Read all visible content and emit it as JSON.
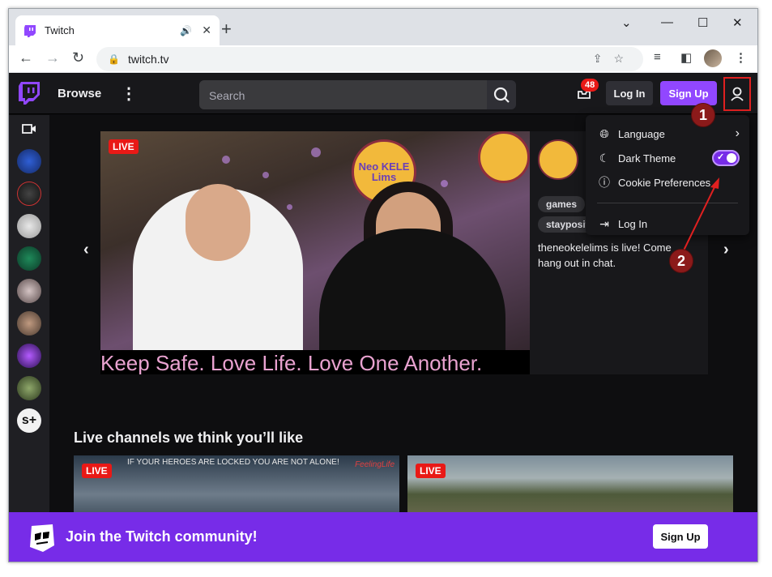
{
  "browser": {
    "tab_title": "Twitch",
    "url": "twitch.tv",
    "new_tab": "+",
    "minimize": "⌄",
    "maximize": "☐",
    "close": "✕"
  },
  "twitch_nav": {
    "browse": "Browse",
    "search_placeholder": "Search",
    "notifications_count": "48",
    "login": "Log In",
    "signup": "Sign Up"
  },
  "featured": {
    "live_label": "LIVE",
    "caption": "Keep Safe. Love Life. Love One Another.",
    "tags": [
      "games",
      "staypositive"
    ],
    "description": "theneokelelims is live! Come hang out in chat.",
    "sign_text": "Neo KELE Lims"
  },
  "user_menu": {
    "language": "Language",
    "dark_theme": "Dark Theme",
    "dark_theme_on": true,
    "cookie": "Cookie Preferences",
    "login": "Log In"
  },
  "annotations": {
    "step1": "1",
    "step2": "2"
  },
  "section": {
    "title": "Live channels we think you’ll like",
    "thumb1_live": "LIVE",
    "thumb1_hud": "IF YOUR HEROES ARE LOCKED YOU ARE NOT ALONE!",
    "thumb1_logo": "FeelingLife",
    "thumb2_live": "LIVE"
  },
  "banner": {
    "text": "Join the Twitch community!",
    "signup": "Sign Up"
  },
  "colors": {
    "twitch_purple": "#9147ff",
    "banner_purple": "#772ce8",
    "live_red": "#e91916",
    "annotation_red": "#e02020"
  }
}
